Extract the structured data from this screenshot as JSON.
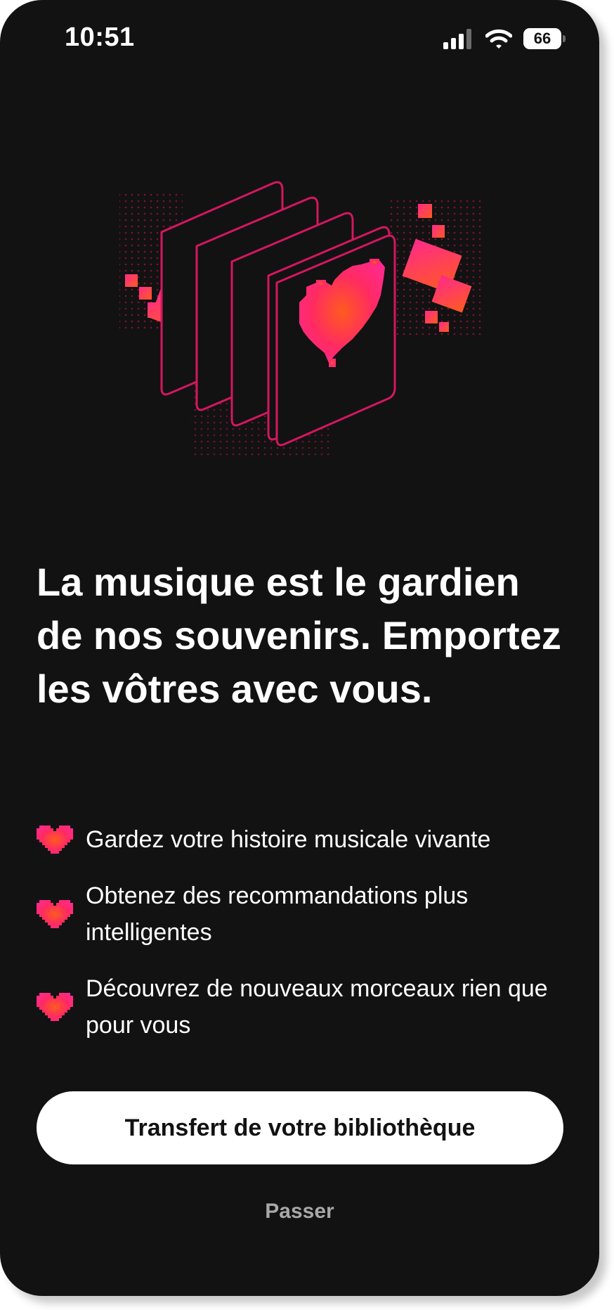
{
  "status_bar": {
    "time": "10:51",
    "battery_level": "66",
    "icons": [
      "cellular-signal-icon",
      "wifi-icon",
      "battery-icon"
    ]
  },
  "hero": {
    "icon": "pixel-heart-cards-illustration"
  },
  "headline": "La musique est le gardien de nos souvenirs. Emportez les vôtres avec vous.",
  "features": [
    {
      "icon": "pixel-heart-icon",
      "text": "Gardez votre histoire musicale vivante"
    },
    {
      "icon": "pixel-heart-icon",
      "text": "Obtenez des recommandations plus intelligentes"
    },
    {
      "icon": "pixel-heart-icon",
      "text": "Découvrez de nouveaux morceaux rien que pour vous"
    }
  ],
  "primary_button": {
    "label": "Transfert de votre bibliothèque"
  },
  "skip_link": {
    "label": "Passer"
  },
  "colors": {
    "background": "#121212",
    "accent_pink": "#ff2a78",
    "accent_orange": "#ff5a1f",
    "text_primary": "#ffffff",
    "text_muted": "#a8a8a8",
    "button_bg": "#ffffff"
  }
}
